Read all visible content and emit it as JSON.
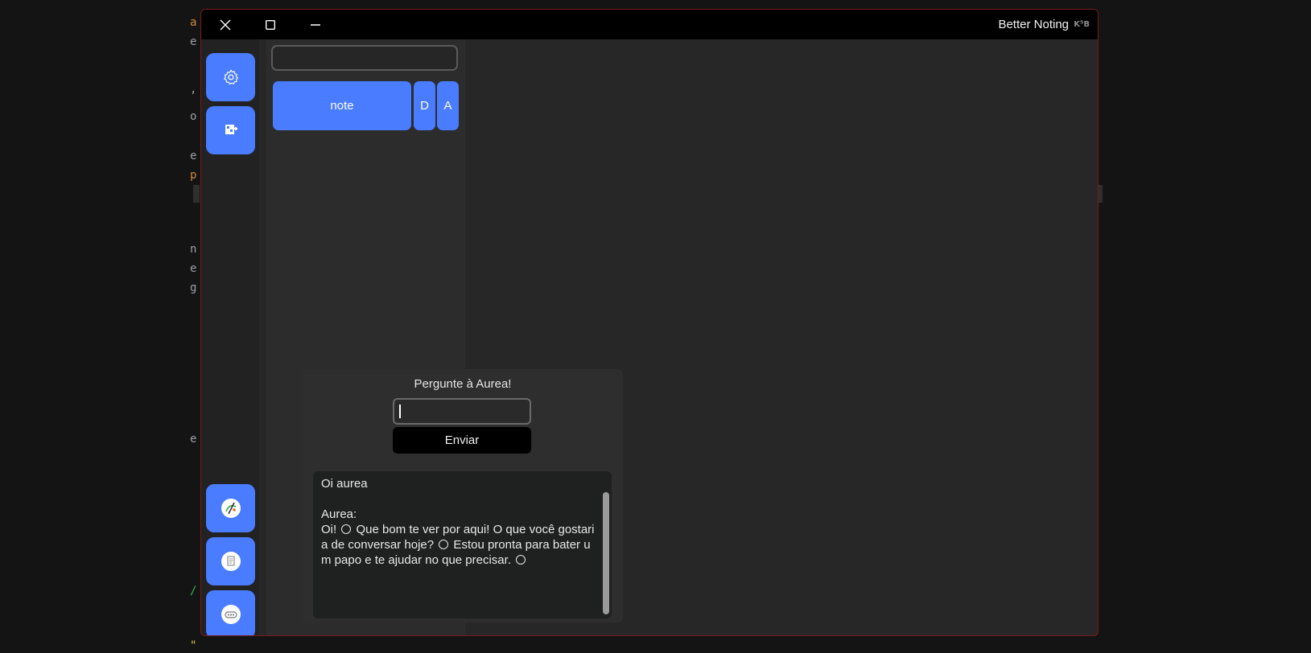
{
  "window": {
    "title": "Better Noting",
    "badge": "K⁵B"
  },
  "titlebar": {
    "close_icon": "close-icon",
    "maximize_icon": "maximize-icon",
    "minimize_icon": "minimize-icon"
  },
  "sidebar": {
    "top_buttons": [
      {
        "icon": "gear-icon"
      },
      {
        "icon": "add-note-icon"
      }
    ],
    "bottom_buttons": [
      {
        "icon": "draw-icon"
      },
      {
        "icon": "document-icon"
      },
      {
        "icon": "chat-icon"
      }
    ]
  },
  "notes": {
    "search_value": "",
    "items": [
      {
        "label": "note",
        "delete_label": "D",
        "edit_label": "A"
      }
    ]
  },
  "chat": {
    "title": "Pergunte à Aurea!",
    "input_value": "",
    "send_label": "Enviar",
    "user_message": "Oi aurea",
    "assistant_name": "Aurea:",
    "reply_parts": [
      "Oi! ",
      " Que bom te ver por aqui! O que você gostaria de conversar hoje? ",
      " Estou pronta para bater um papo e te ajudar no que precisar. "
    ]
  },
  "colors": {
    "accent": "#4a7cff",
    "background": "#141414",
    "window": "#272727",
    "titlebar": "#000000"
  }
}
